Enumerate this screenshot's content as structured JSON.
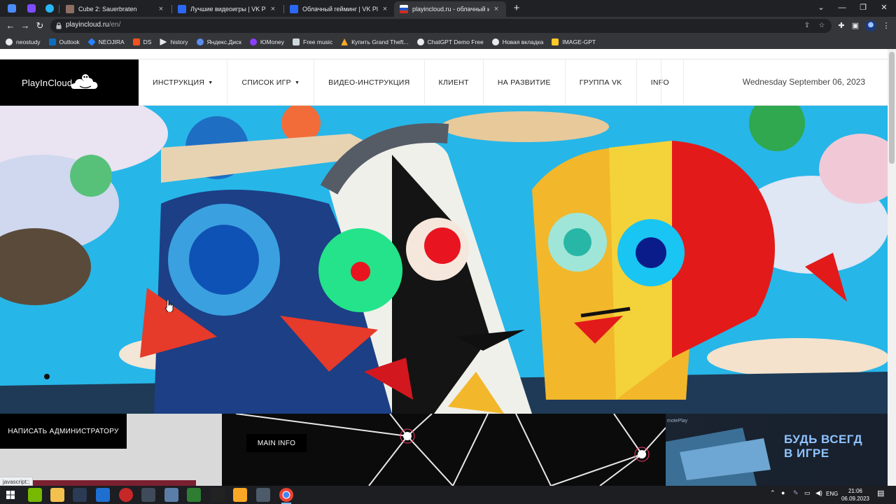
{
  "browser": {
    "tabs": [
      {
        "title": "Cube 2: Sauerbraten",
        "close": "×"
      },
      {
        "title": "Лучшие видеоигры | VK Play",
        "close": "×"
      },
      {
        "title": "Облачный гейминг | VK Play",
        "close": "×"
      },
      {
        "title": "playincloud.ru - облачный игро",
        "close": "×",
        "active": true
      }
    ],
    "new_tab": "+",
    "url_host": "playincloud.ru",
    "url_path": "/en/",
    "bookmarks": [
      {
        "label": "neostudy",
        "color": "#e8eaed"
      },
      {
        "label": "Outlook",
        "color": "#0f6cbd"
      },
      {
        "label": "NEOJIRA",
        "color": "#2684ff"
      },
      {
        "label": "DS",
        "color": "#f4511e"
      },
      {
        "label": "history",
        "color": "#e8eaed"
      },
      {
        "label": "Яндекс.Диск",
        "color": "#5b8def"
      },
      {
        "label": "ЮMoney",
        "color": "#8b3ffd"
      },
      {
        "label": "Free music",
        "color": "#cfd8dc"
      },
      {
        "label": "Купить Grand Theft...",
        "color": "#f9a825"
      },
      {
        "label": "ChatGPT Demo Free",
        "color": "#e8eaed"
      },
      {
        "label": "Новая вкладка",
        "color": "#e8eaed"
      },
      {
        "label": "IMAGE-GPT",
        "color": "#ffca28"
      }
    ]
  },
  "site": {
    "logo_text": "PlayInCloud",
    "menu": [
      {
        "label": "ИНСТРУКЦИЯ",
        "caret": "▼"
      },
      {
        "label": "СПИСОК ИГР",
        "caret": "▼"
      },
      {
        "label": "ВИДЕО-ИНСТРУКЦИЯ"
      },
      {
        "label": "КЛИЕНТ"
      },
      {
        "label": "НА РАЗВИТИЕ"
      },
      {
        "label": "ГРУППА VK"
      },
      {
        "label": "INFO"
      }
    ],
    "date": "Wednesday September 06, 2023",
    "buttons": {
      "admin": "НАПИСАТЬ АДМИНИСТРАТОРУ",
      "main_info": "MAIN INFO"
    },
    "promo": {
      "small": "motePlay",
      "big": "БУДЬ ВСЕГД\nВ ИГРЕ"
    },
    "status_bar": "javascript:;"
  },
  "taskbar": {
    "lang": "ENG",
    "time": "21:06",
    "date": "06.09.2023"
  },
  "colors": {
    "tab_bg": "#202124",
    "toolbar_bg": "#35363a",
    "accent_dark": "#000000",
    "sky": "#27b6e8"
  }
}
